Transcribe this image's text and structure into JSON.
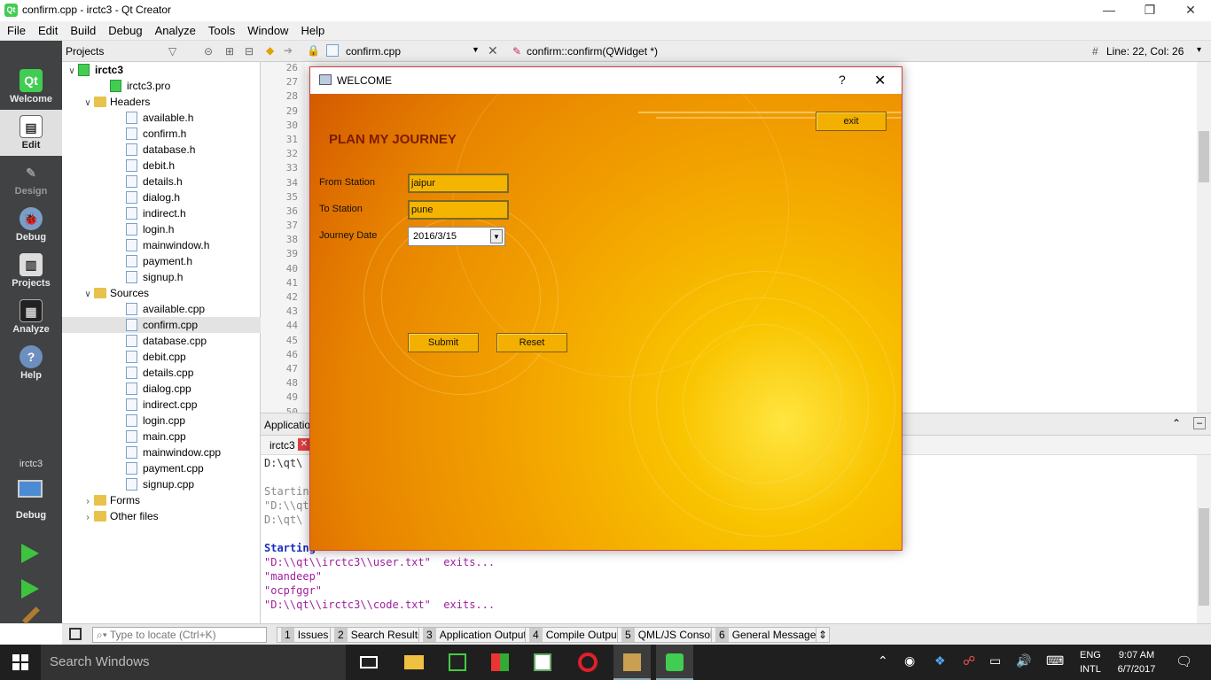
{
  "window": {
    "title": "confirm.cpp - irctc3 - Qt Creator",
    "min": "—",
    "max": "❐",
    "close": "✕",
    "icon_text": "Qt"
  },
  "menu": [
    "File",
    "Edit",
    "Build",
    "Debug",
    "Analyze",
    "Tools",
    "Window",
    "Help"
  ],
  "modes": [
    {
      "label": "Welcome",
      "icon": "Qt"
    },
    {
      "label": "Edit",
      "icon": "▤"
    },
    {
      "label": "Design",
      "icon": "✎"
    },
    {
      "label": "Debug",
      "icon": "🐞"
    },
    {
      "label": "Projects",
      "icon": "▥"
    },
    {
      "label": "Analyze",
      "icon": "▦"
    },
    {
      "label": "Help",
      "icon": "?"
    }
  ],
  "kit": {
    "project": "irctc3",
    "mode": "Debug"
  },
  "projects": {
    "header": "Projects",
    "root": "irctc3",
    "pro": "irctc3.pro",
    "headers_label": "Headers",
    "headers": [
      "available.h",
      "confirm.h",
      "database.h",
      "debit.h",
      "details.h",
      "dialog.h",
      "indirect.h",
      "login.h",
      "mainwindow.h",
      "payment.h",
      "signup.h"
    ],
    "sources_label": "Sources",
    "sources": [
      "available.cpp",
      "confirm.cpp",
      "database.cpp",
      "debit.cpp",
      "details.cpp",
      "dialog.cpp",
      "indirect.cpp",
      "login.cpp",
      "main.cpp",
      "mainwindow.cpp",
      "payment.cpp",
      "signup.cpp"
    ],
    "forms": "Forms",
    "other": "Other files"
  },
  "editor": {
    "file": "confirm.cpp",
    "symbol": "confirm::confirm(QWidget *)",
    "position": "Line: 22, Col: 26",
    "hash": "#",
    "lines": [
      "26",
      "27",
      "28",
      "29",
      "30",
      "31",
      "32",
      "33",
      "34",
      "35",
      "36",
      "37",
      "38",
      "39",
      "40",
      "41",
      "42",
      "43",
      "44",
      "45",
      "46",
      "47",
      "48",
      "49",
      "50"
    ]
  },
  "output_pane": {
    "title": "Application Output",
    "tab": "irctc3",
    "lines": [
      {
        "t": "D:\\qt\\",
        "c": "#333"
      },
      {
        "t": "Startin",
        "c": "#888"
      },
      {
        "t": "\"D:\\\\qt",
        "c": "#888"
      },
      {
        "t": "D:\\qt\\",
        "c": "#888"
      },
      {
        "t": "Starting",
        "c": "#1a2ec0"
      },
      {
        "t": "\"D:\\\\qt\\\\irctc3\\\\user.txt\"  exits...",
        "c": "#a020a0"
      },
      {
        "t": "\"mandeep\"",
        "c": "#a020a0"
      },
      {
        "t": "\"ocpfggr\"",
        "c": "#a020a0"
      },
      {
        "t": "\"D:\\\\qt\\\\irctc3\\\\code.txt\"  exits...",
        "c": "#a020a0"
      }
    ]
  },
  "statusbar": {
    "locate_placeholder": "Type to locate (Ctrl+K)",
    "tabs": [
      {
        "n": "1",
        "label": "Issues"
      },
      {
        "n": "2",
        "label": "Search Results"
      },
      {
        "n": "3",
        "label": "Application Output"
      },
      {
        "n": "4",
        "label": "Compile Output"
      },
      {
        "n": "5",
        "label": "QML/JS Console"
      },
      {
        "n": "6",
        "label": "General Messages"
      }
    ]
  },
  "dialog": {
    "title": "WELCOME",
    "help": "?",
    "close": "✕",
    "heading": "PLAN MY JOURNEY",
    "exit": "exit",
    "from_label": "From Station",
    "from_value": "jaipur",
    "to_label": "To Station",
    "to_value": "pune",
    "date_label": "Journey Date",
    "date_value": "2016/3/15",
    "submit": "Submit",
    "reset": "Reset"
  },
  "taskbar": {
    "search": "Search Windows",
    "lang1": "ENG",
    "lang2": "INTL",
    "time": "9:07 AM",
    "date": "6/7/2017"
  }
}
